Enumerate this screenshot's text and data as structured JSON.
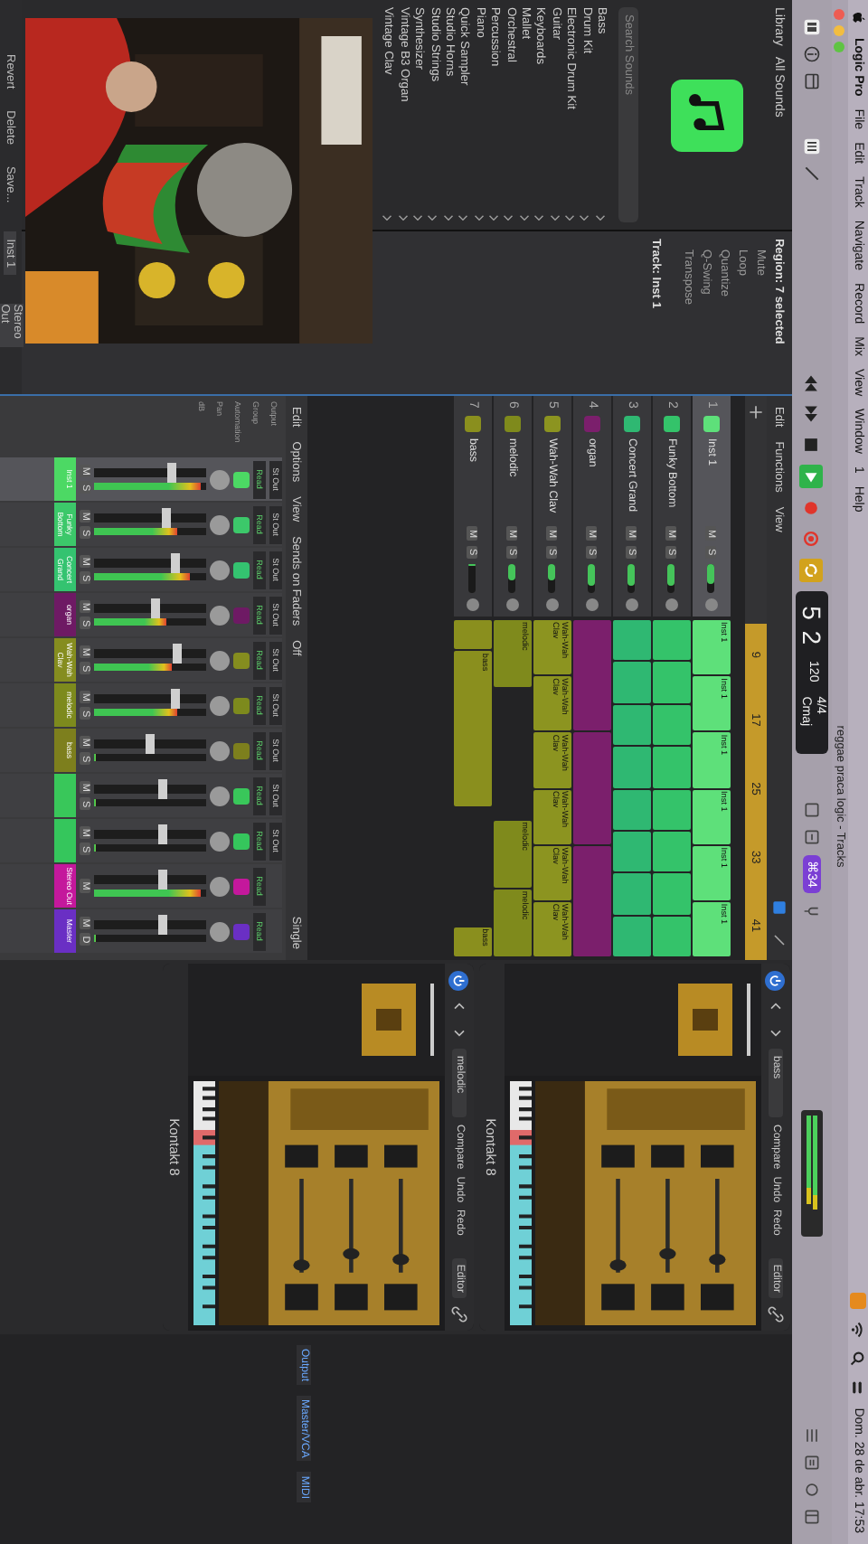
{
  "menu_bar": {
    "app": "Logic Pro",
    "items": [
      "File",
      "Edit",
      "Track",
      "Navigate",
      "Record",
      "Mix",
      "View",
      "Window",
      "1",
      "Help"
    ],
    "clock": "Dom. 28 de abr.  17:53"
  },
  "window_title": "reggae praca logic - Tracks",
  "lcd": {
    "position": "5 2",
    "tempo": "120",
    "signature": "4/4",
    "key": "Cmaj"
  },
  "badge": "⌘34",
  "library": {
    "title": "Library",
    "filter": "All Sounds",
    "search_placeholder": "Search Sounds",
    "categories": [
      "Bass",
      "Drum Kit",
      "Electronic Drum Kit",
      "Guitar",
      "Keyboards",
      "Mallet",
      "Orchestral",
      "Percussion",
      "Piano",
      "Quick Sampler",
      "Studio Horns",
      "Studio Strings",
      "Synthesizer",
      "Vintage B3 Organ",
      "Vintage Clav"
    ],
    "buttons": [
      "Revert",
      "Delete",
      "Save..."
    ]
  },
  "inspector": {
    "region_header": "Region: 7 selected",
    "region_rows": [
      "Mute",
      "Loop",
      "Quantize",
      "Q-Swing",
      "Transpose"
    ],
    "track_header": "Track: Inst 1",
    "strip_labels": [
      "Inst 1",
      "Stereo Out"
    ]
  },
  "tracks_window": {
    "menus": [
      "Edit",
      "Functions",
      "View"
    ],
    "ruler": [
      "9",
      "17",
      "25",
      "33",
      "41"
    ],
    "tracks": [
      {
        "number": "1",
        "name": "Inst 1",
        "color": "#5ee07a",
        "selected": true,
        "level": 0.72,
        "buttons": [
          "M",
          "S"
        ],
        "regions": [
          {
            "kind": "region",
            "name": "Inst 1"
          },
          {
            "kind": "region",
            "name": "Inst 1"
          },
          {
            "kind": "region",
            "name": "Inst 1"
          },
          {
            "kind": "region",
            "name": "Inst 1"
          },
          {
            "kind": "region",
            "name": "Inst 1"
          },
          {
            "kind": "region",
            "name": "Inst 1"
          }
        ]
      },
      {
        "number": "2",
        "name": "Funky Bottom",
        "color": "#34c36a",
        "selected": false,
        "level": 0.78,
        "buttons": [
          "M",
          "S"
        ],
        "regions": [
          {
            "kind": "region"
          },
          {
            "kind": "region"
          },
          {
            "kind": "region"
          },
          {
            "kind": "region"
          },
          {
            "kind": "region"
          },
          {
            "kind": "region"
          },
          {
            "kind": "region"
          },
          {
            "kind": "region"
          }
        ]
      },
      {
        "number": "3",
        "name": "Concert Grand",
        "color": "#2fb872",
        "selected": false,
        "level": 0.78,
        "buttons": [
          "M",
          "S"
        ],
        "regions": [
          {
            "kind": "region"
          },
          {
            "kind": "region"
          },
          {
            "kind": "region"
          },
          {
            "kind": "region"
          },
          {
            "kind": "region"
          },
          {
            "kind": "region"
          },
          {
            "kind": "region"
          },
          {
            "kind": "region"
          }
        ]
      },
      {
        "number": "4",
        "name": "organ",
        "color": "#7b1f6c",
        "selected": false,
        "level": 0.78,
        "buttons": [
          "M",
          "S"
        ],
        "regions": [
          {
            "kind": "long"
          },
          {
            "kind": "long"
          },
          {
            "kind": "long"
          }
        ]
      },
      {
        "number": "5",
        "name": "Wah-Wah Clav",
        "color": "#8c9420",
        "selected": false,
        "level": 0.6,
        "buttons": [
          "M",
          "S"
        ],
        "regions": [
          {
            "kind": "region",
            "name": "Wah-Wah Clav"
          },
          {
            "kind": "region",
            "name": "Wah-Wah Clav"
          },
          {
            "kind": "region",
            "name": "Wah-Wah Clav"
          },
          {
            "kind": "region",
            "name": "Wah-Wah Clav"
          },
          {
            "kind": "region",
            "name": "Wah-Wah Clav"
          },
          {
            "kind": "region",
            "name": "Wah-Wah Clav"
          }
        ]
      },
      {
        "number": "6",
        "name": "melodic",
        "color": "#7f8a1c",
        "selected": false,
        "level": 0.6,
        "buttons": [
          "M",
          "S"
        ],
        "regions": [
          {
            "kind": "region",
            "name": "melodic"
          },
          {
            "kind": "gap"
          },
          {
            "kind": "gap"
          },
          {
            "kind": "region",
            "name": "melodic"
          },
          {
            "kind": "region",
            "name": "melodic"
          }
        ]
      },
      {
        "number": "7",
        "name": "bass",
        "color": "#8a8f1e",
        "selected": false,
        "level": 0.1,
        "buttons": [
          "M",
          "S"
        ],
        "regions": [
          {
            "kind": "short"
          },
          {
            "kind": "long",
            "name": "bass"
          },
          {
            "kind": "gap"
          },
          {
            "kind": "gap"
          },
          {
            "kind": "short",
            "name": "bass"
          }
        ]
      }
    ]
  },
  "mixer": {
    "menus": [
      "Edit",
      "Options",
      "View",
      "Sends on Faders",
      "Off"
    ],
    "view_button": "Single",
    "row_labels": [
      "Output",
      "Group",
      "Automation",
      "Pan",
      "dB"
    ],
    "strips": [
      {
        "name": "Inst 1",
        "color": "#4cd964",
        "selected": true,
        "output": "St Out",
        "automation": "Read",
        "buttons": [
          "M",
          "S"
        ],
        "fader": {
          "level": 0.7
        },
        "meter": {
          "level": 0.95
        }
      },
      {
        "name": "Funky Bottom",
        "color": "#3cc86a",
        "selected": false,
        "output": "St Out",
        "automation": "Read",
        "buttons": [
          "M",
          "S"
        ],
        "fader": {
          "level": 0.65
        },
        "meter": {
          "level": 0.75
        }
      },
      {
        "name": "Concert Grand",
        "color": "#34c370",
        "selected": false,
        "output": "St Out",
        "automation": "Read",
        "buttons": [
          "M",
          "S"
        ],
        "fader": {
          "level": 0.72
        },
        "meter": {
          "level": 0.85
        }
      },
      {
        "name": "organ",
        "color": "#6e1a64",
        "selected": false,
        "output": "St Out",
        "automation": "Read",
        "buttons": [
          "M",
          "S"
        ],
        "fader": {
          "level": 0.55
        },
        "meter": {
          "level": 0.65
        }
      },
      {
        "name": "Wah-Wah Clav",
        "color": "#858d1f",
        "selected": false,
        "output": "St Out",
        "automation": "Read",
        "buttons": [
          "M",
          "S"
        ],
        "fader": {
          "level": 0.75
        },
        "meter": {
          "level": 0.7
        }
      },
      {
        "name": "melodic",
        "color": "#7d8a1d",
        "selected": false,
        "output": "St Out",
        "automation": "Read",
        "buttons": [
          "M",
          "S"
        ],
        "fader": {
          "level": 0.72
        },
        "meter": {
          "level": 0.75
        }
      },
      {
        "name": "bass",
        "color": "#7d7f1d",
        "selected": false,
        "output": "St Out",
        "automation": "Read",
        "buttons": [
          "M",
          "S"
        ],
        "fader": {
          "level": 0.5
        },
        "meter": {
          "level": 0
        }
      },
      {
        "color": "#39c75a",
        "selected": false,
        "output": "St Out",
        "automation": "Read",
        "buttons": [
          "M",
          "S"
        ],
        "fader": {
          "level": 0.62
        },
        "meter": {
          "level": 0
        }
      },
      {
        "color": "#35c65c",
        "selected": false,
        "output": "St Out",
        "automation": "Read",
        "buttons": [
          "M",
          "S"
        ],
        "fader": {
          "level": 0.62
        },
        "meter": {
          "level": 0
        }
      },
      {
        "name": "Stereo Out",
        "color": "#c4189c",
        "selected": false,
        "automation": "Read",
        "buttons": [
          "M"
        ],
        "fader": {
          "level": 0.62
        },
        "meter": {
          "level": 0.95
        }
      },
      {
        "name": "Master",
        "color": "#6a2fc4",
        "selected": false,
        "automation": "Read",
        "buttons": [
          "M",
          "D"
        ],
        "fader": {
          "level": 0.62
        },
        "meter": {
          "level": 0
        }
      }
    ]
  },
  "filters": [
    "Output",
    "Master/VCA",
    "MIDI"
  ],
  "plugin_windows": [
    {
      "preset": "bass",
      "buttons": [
        "Compare",
        "Undo",
        "Redo"
      ],
      "editor": "Editor",
      "footer": "Kontakt 8"
    },
    {
      "preset": "melodic",
      "buttons": [
        "Compare",
        "Undo",
        "Redo"
      ],
      "editor": "Editor",
      "footer": "Kontakt 8"
    }
  ]
}
